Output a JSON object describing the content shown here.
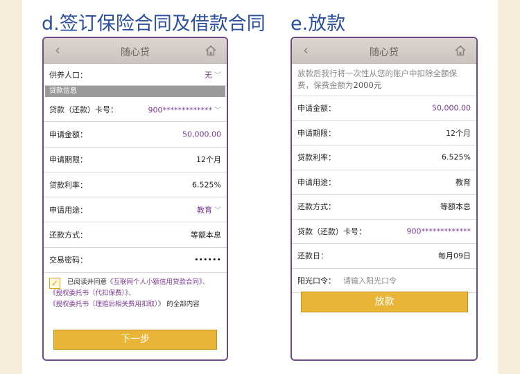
{
  "captions": {
    "left": "d.签订保险合同及借款合同",
    "right": "e.放款"
  },
  "app": {
    "title": "随心贷",
    "back_glyph": "‹"
  },
  "left_screen": {
    "dependents": {
      "label": "供养人口：",
      "value": "无"
    },
    "section_title": "贷款信息",
    "fields": [
      {
        "label": "贷款（还款）卡号：",
        "value": "900*************",
        "chevron": true,
        "purple": true
      },
      {
        "label": "申请金额：",
        "value": "50,000.00",
        "chevron": false,
        "purple": true
      },
      {
        "label": "申请期限：",
        "value": "12个月",
        "chevron": false,
        "purple": false
      },
      {
        "label": "贷款利率：",
        "value": "6.525%",
        "chevron": false,
        "purple": false
      },
      {
        "label": "申请用途：",
        "value": "教育",
        "chevron": true,
        "purple": true
      },
      {
        "label": "还款方式：",
        "value": "等额本息",
        "chevron": false,
        "purple": false
      },
      {
        "label": "交易密码：",
        "value": "••••••",
        "chevron": false,
        "purple": false
      }
    ],
    "agreement": {
      "prefix": "已阅读并同意",
      "doc1": "《互联网个人小额信用贷款合同》、",
      "doc2": "《授权委托书（代扣保费）》、",
      "doc3": "《授权委托书（理赔后相关费用扣取）》",
      "suffix": "的全部内容",
      "checked": true
    },
    "next_button": "下一步"
  },
  "right_screen": {
    "notice_text": "放款后我行将一次性从您的账户中扣除全额保费，保费金额为",
    "notice_amount": "2000元",
    "fields": [
      {
        "label": "申请金额：",
        "value": "50,000.00"
      },
      {
        "label": "申请期限：",
        "value": "12个月"
      },
      {
        "label": "贷款利率：",
        "value": "6.525%"
      },
      {
        "label": "申请用途：",
        "value": "教育"
      },
      {
        "label": "还款方式：",
        "value": "等额本息"
      },
      {
        "label": "贷款（还款）卡号：",
        "value": "900*************"
      },
      {
        "label": "还款日：",
        "value": "每月09日"
      }
    ],
    "sunshine": {
      "label": "阳光口令：",
      "placeholder": "请输入阳光口令"
    },
    "disburse_button": "放款"
  },
  "colors": {
    "accent_gold": "#e8b537",
    "link_purple": "#7a3a92",
    "caption_blue": "#2a4fa0",
    "frame_purple": "#6e4b86"
  },
  "icons": {
    "back": "chevron-left-icon",
    "home": "home-icon",
    "dropdown": "chevron-down-icon",
    "checkbox": "checkbox-checked-icon"
  }
}
